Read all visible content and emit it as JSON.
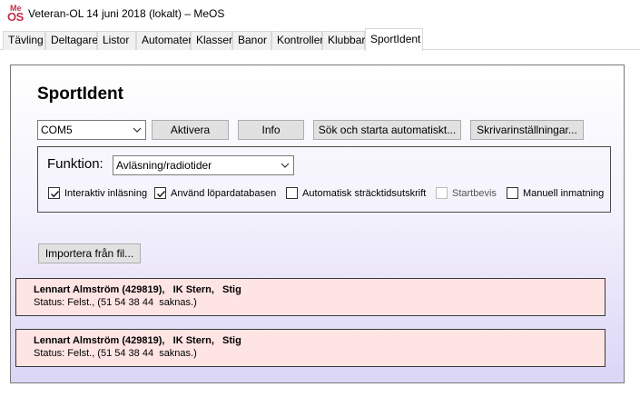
{
  "window": {
    "logo_top": "Me",
    "logo_bottom": "OS",
    "title": "Veteran-OL 14 juni 2018 (lokalt) – MeOS"
  },
  "tabs": [
    {
      "label": "Tävling",
      "active": false
    },
    {
      "label": "Deltagare",
      "active": false
    },
    {
      "label": "Listor",
      "active": false
    },
    {
      "label": "Automater",
      "active": false
    },
    {
      "label": "Klasser",
      "active": false
    },
    {
      "label": "Banor",
      "active": false
    },
    {
      "label": "Kontroller",
      "active": false
    },
    {
      "label": "Klubbar",
      "active": false
    },
    {
      "label": "SportIdent",
      "active": true
    }
  ],
  "panel": {
    "title": "SportIdent",
    "port": {
      "selected": "COM5"
    },
    "buttons": {
      "activate": "Aktivera",
      "info": "Info",
      "auto_search": "Sök och starta automatiskt...",
      "printer_settings": "Skrivarinställningar...",
      "import_file": "Importera från fil..."
    },
    "funktion": {
      "label": "Funktion:",
      "selected": "Avläsning/radiotider"
    },
    "options": [
      {
        "label": "Interaktiv inläsning",
        "checked": true,
        "enabled": true
      },
      {
        "label": "Använd löpardatabasen",
        "checked": true,
        "enabled": true
      },
      {
        "label": "Automatisk sträcktidsutskrift",
        "checked": false,
        "enabled": true
      },
      {
        "label": "Startbevis",
        "checked": false,
        "enabled": false
      },
      {
        "label": "Manuell inmatning",
        "checked": false,
        "enabled": true
      }
    ],
    "readouts": [
      {
        "runner": "Lennart Almström (429819),   IK Stern,   Stig",
        "status": "Status: Felst., (51 54 38 44  saknas.)"
      },
      {
        "runner": "Lennart Almström (429819),   IK Stern,   Stig",
        "status": "Status: Felst., (51 54 38 44  saknas.)"
      }
    ]
  }
}
